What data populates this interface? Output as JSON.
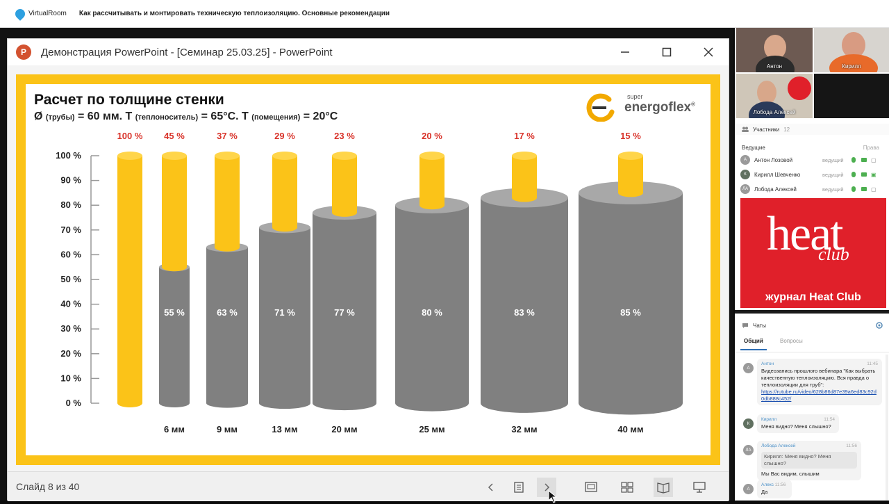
{
  "topbar": {
    "app_name": "VirtualRoom",
    "meeting_title": "Как рассчитывать и монтировать техническую теплоизоляцию. Основные рекомендации"
  },
  "ppt": {
    "window_title": "Демонстрация PowerPoint - [Семинар 25.03.25] - PowerPoint",
    "icon_letter": "P",
    "slide_counter": "Слайд 8 из 40"
  },
  "slide": {
    "title": "Расчет по толщине стенки",
    "subtitle": {
      "d_sym": "Ø",
      "d_sub": "(трубы)",
      "d_val": "= 60 мм. T",
      "t1_sub": "(теплоноситель)",
      "t1_val": "= 65°C. T",
      "t2_sub": "(помещения)",
      "t2_val": "= 20°C"
    },
    "brand_super": "super",
    "brand_name": "energoflex",
    "brand_mark": "®"
  },
  "chart_data": {
    "type": "bar",
    "categories": [
      "",
      "6 мм",
      "9 мм",
      "13 мм",
      "20 мм",
      "25 мм",
      "32 мм",
      "40 мм"
    ],
    "series": [
      {
        "name": "",
        "values": [
          100,
          45,
          37,
          29,
          23,
          20,
          17,
          15
        ]
      },
      {
        "name": "",
        "values": [
          0,
          55,
          63,
          71,
          77,
          80,
          83,
          85
        ]
      }
    ],
    "top_labels": [
      "100 %",
      "45 %",
      "37 %",
      "29 %",
      "23 %",
      "20 %",
      "17 %",
      "15 %"
    ],
    "inner_labels": [
      "",
      "55 %",
      "63 %",
      "71 %",
      "77 %",
      "80 %",
      "83 %",
      "85 %"
    ],
    "yticks": [
      "0 %",
      "10 %",
      "20 %",
      "30 %",
      "40 %",
      "50 %",
      "60 %",
      "70 %",
      "80 %",
      "90 %",
      "100 %"
    ],
    "ylim": [
      0,
      100
    ],
    "colors": {
      "pipe": "#fbc318",
      "insulation": "#808080",
      "top_label": "#d9342b"
    }
  },
  "participants": {
    "videos": [
      {
        "name": "Антон"
      },
      {
        "name": "Кирилл"
      },
      {
        "name": "Лобода Алексей"
      }
    ],
    "header": "Участники",
    "count": "12",
    "group": "Ведущие",
    "rights": "Права",
    "list": [
      {
        "initials": "А",
        "name": "Антон Лозовой",
        "role": "ведущий"
      },
      {
        "initials": "К",
        "name": "Кирилл Шевченко",
        "role": "ведущий"
      },
      {
        "initials": "ЛА",
        "name": "Лобода Алексей",
        "role": "ведущий"
      }
    ]
  },
  "banner": {
    "word": "heat",
    "club": "club",
    "caption": "журнал Heat Club"
  },
  "chat": {
    "header": "Чаты",
    "tabs": [
      "Общий",
      "Вопросы"
    ],
    "messages": [
      {
        "initials": "А",
        "author": "Антон",
        "time": "11:45",
        "text": "Видеозапись прошлого вебинара \"Как выбрать качественную теплоизоляцию. Вся правда о теплоизоляции для труб\":",
        "link": "https://rutube.ru/video/628b86d87e39a6ed83c92d0db888c452/"
      },
      {
        "initials": "К",
        "author": "Кирилл",
        "time": "11:54",
        "text": "Меня видно? Меня слышно?"
      },
      {
        "initials": "ЛА",
        "author": "Лобода Алексей",
        "time": "11:56",
        "quote": "Кирилл: Меня видно? Меня слышно?",
        "text": "Мы Вас видим, слышим"
      },
      {
        "initials": "А",
        "author": "Алекс",
        "time": "11:56",
        "text": "Да"
      }
    ]
  }
}
